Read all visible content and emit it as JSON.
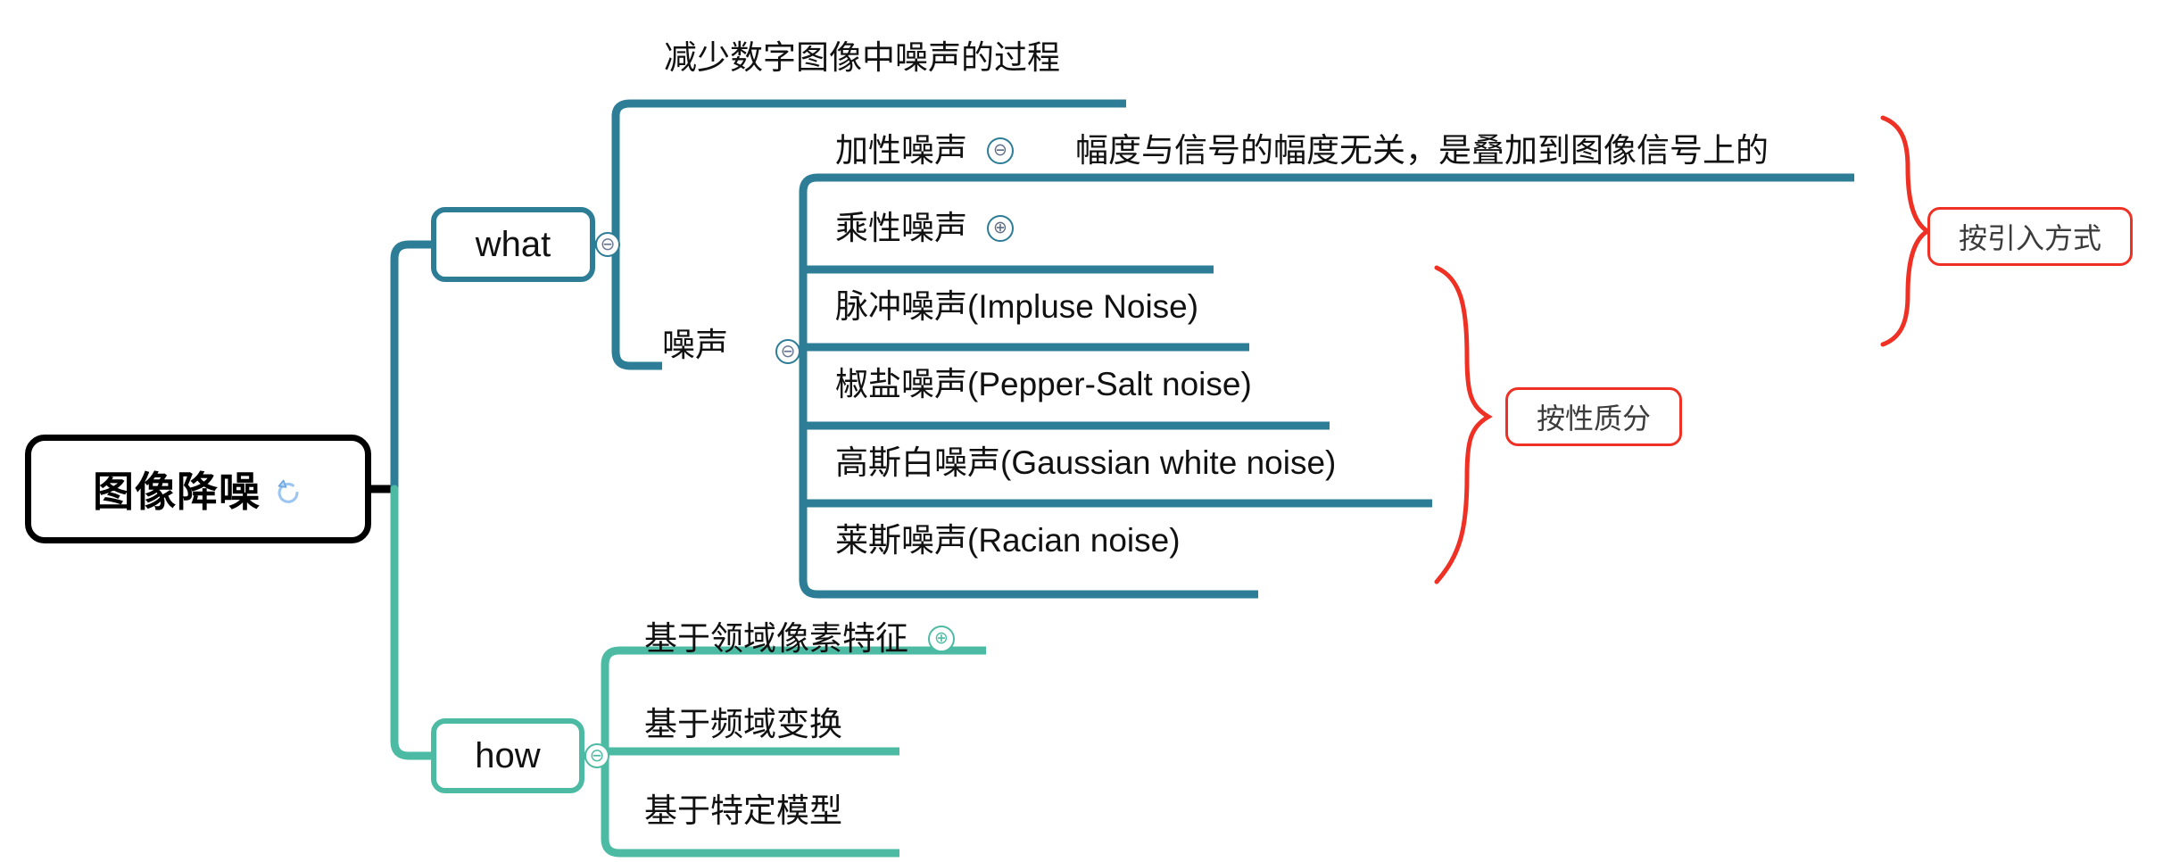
{
  "mindmap": {
    "title": "图像降噪",
    "root": {
      "label": "图像降噪",
      "icon": "refresh-arrow-icon",
      "border_color": "#000000"
    },
    "branches": [
      {
        "id": "what",
        "label": "what",
        "color": "#2E7D97",
        "toggle": "minus",
        "children": [
          {
            "id": "definition",
            "label": "减少数字图像中噪声的过程",
            "toggle": null
          },
          {
            "id": "noise",
            "label": "噪声",
            "toggle": "minus",
            "children": [
              {
                "id": "additive-noise",
                "label": "加性噪声",
                "toggle": "minus",
                "detail": "幅度与信号的幅度无关，是叠加到图像信号上的"
              },
              {
                "id": "multiplicative-noise",
                "label": "乘性噪声",
                "toggle": "plus"
              },
              {
                "id": "impulse-noise",
                "label": "脉冲噪声(Impluse Noise)",
                "toggle": null
              },
              {
                "id": "pepper-salt-noise",
                "label": "椒盐噪声(Pepper-Salt noise)",
                "toggle": null
              },
              {
                "id": "gaussian-white-noise",
                "label": "高斯白噪声(Gaussian white noise)",
                "toggle": null
              },
              {
                "id": "rician-noise",
                "label": "莱斯噪声(Racian noise)",
                "toggle": null
              }
            ]
          }
        ]
      },
      {
        "id": "how",
        "label": "how",
        "color": "#4DBBA4",
        "toggle": "minus",
        "children": [
          {
            "id": "neighborhood-pixel-feature",
            "label": "基于领域像素特征",
            "toggle": "plus"
          },
          {
            "id": "frequency-domain-transform",
            "label": "基于频域变换",
            "toggle": null
          },
          {
            "id": "specific-model",
            "label": "基于特定模型",
            "toggle": null
          }
        ]
      }
    ],
    "annotations": [
      {
        "id": "by-introduction-method",
        "label": "按引入方式",
        "color": "#EE3124",
        "groups": [
          "加性噪声",
          "乘性噪声"
        ]
      },
      {
        "id": "by-nature",
        "label": "按性质分",
        "color": "#EE3124",
        "groups": [
          "脉冲噪声",
          "椒盐噪声",
          "高斯白噪声",
          "莱斯噪声"
        ]
      }
    ],
    "icons": {
      "minus": "⊖",
      "plus": "⊕"
    },
    "colors": {
      "what_branch": "#2E7D97",
      "how_branch": "#4DBBA4",
      "root_border": "#000000",
      "annotation": "#EE3124",
      "text": "#111111"
    }
  }
}
